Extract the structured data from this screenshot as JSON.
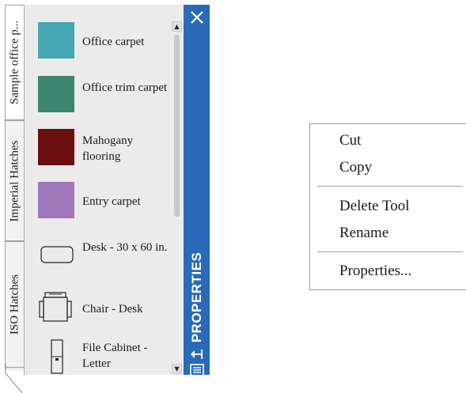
{
  "palette": {
    "title": "PROPERTIES",
    "tabs": [
      {
        "label": "Sample office p..."
      },
      {
        "label": "Imperial Hatches"
      },
      {
        "label": "ISO Hatches"
      }
    ],
    "tools": [
      {
        "label": "Office carpet",
        "icon": "swatch",
        "color": "#45a7b2"
      },
      {
        "label": "Office trim carpet",
        "icon": "swatch",
        "color": "#3d8670"
      },
      {
        "label": "Mahogany flooring",
        "icon": "swatch",
        "color": "#6b0e10"
      },
      {
        "label": "Entry carpet",
        "icon": "swatch",
        "color": "#a177bb"
      },
      {
        "label": "Desk - 30 x 60 in.",
        "icon": "desk-icon"
      },
      {
        "label": "Chair - Desk",
        "icon": "chair-icon"
      },
      {
        "label": "File Cabinet - Letter",
        "icon": "file-cabinet-icon"
      }
    ],
    "accent": "#2a6ab8"
  },
  "context_menu": {
    "items": [
      {
        "label": "Cut"
      },
      {
        "label": "Copy"
      },
      {
        "label": "Delete Tool"
      },
      {
        "label": "Rename"
      },
      {
        "label": "Properties..."
      }
    ]
  }
}
